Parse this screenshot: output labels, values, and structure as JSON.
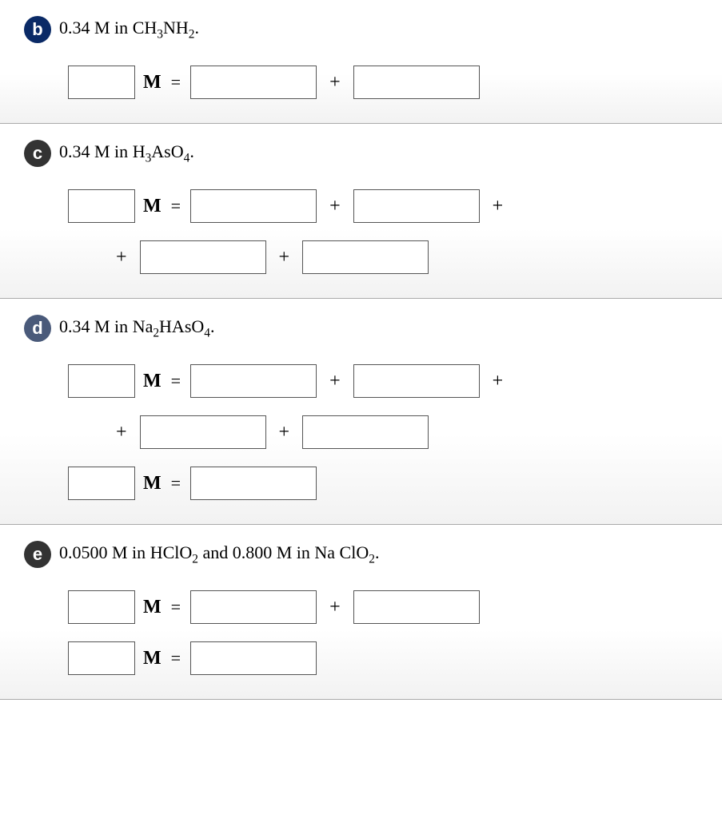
{
  "symbols": {
    "unit_m": "M",
    "equals": "=",
    "plus": "+"
  },
  "parts": {
    "b": {
      "badge": "b",
      "prompt_prefix": "0.34 M in ",
      "formula_html": "CH<sub>3</sub>NH<sub>2</sub>",
      "prompt_suffix": "."
    },
    "c": {
      "badge": "c",
      "prompt_prefix": "0.34 M in ",
      "formula_html": "H<sub>3</sub>AsO<sub>4</sub>",
      "prompt_suffix": "."
    },
    "d": {
      "badge": "d",
      "prompt_prefix": "0.34 M in ",
      "formula_html": "Na<sub>2</sub>HAsO<sub>4</sub>",
      "prompt_suffix": "."
    },
    "e": {
      "badge": "e",
      "prompt_prefix": "0.0500 M in ",
      "formula1_html": "HClO<sub>2</sub>",
      "prompt_mid": " and 0.800 M in  ",
      "formula2_html": "Na ClO<sub>2</sub>",
      "prompt_suffix": "."
    }
  }
}
